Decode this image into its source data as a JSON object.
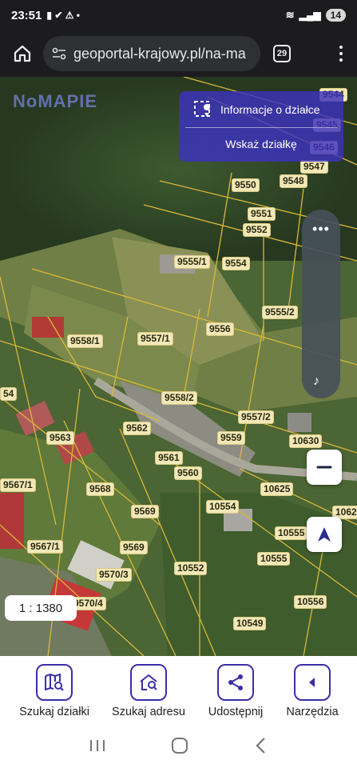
{
  "status": {
    "time": "23:51",
    "battery": "14"
  },
  "browser": {
    "url": "geoportal-krajowy.pl/na-ma",
    "tab_count": "29"
  },
  "map": {
    "logo": "NoMAPIE",
    "info_panel": {
      "title": "Informacje o działce",
      "action": "Wskaż działkę"
    },
    "zoom_dots": "•••",
    "scale": "1 : 1380",
    "parcels": [
      "9544",
      "9545",
      "9546",
      "9547",
      "9550",
      "9548",
      "9551",
      "9552",
      "9555/1",
      "9554",
      "9555/2",
      "9556",
      "9558/1",
      "9557/1",
      "9558/2",
      "9557/2",
      "9559",
      "10630",
      "9563",
      "9562",
      "9561",
      "9560",
      "9567/1",
      "9568",
      "9569",
      "10554",
      "10625",
      "10555",
      "9567/1",
      "9569",
      "10552",
      "10555",
      "9570/3",
      "9570/4",
      "10556",
      "10549",
      "1062",
      "54"
    ]
  },
  "bottom_nav": [
    {
      "label": "Szukaj działki",
      "icon": "map-search-icon"
    },
    {
      "label": "Szukaj adresu",
      "icon": "home-search-icon"
    },
    {
      "label": "Udostępnij",
      "icon": "share-icon"
    },
    {
      "label": "Narzędzia",
      "icon": "chevron-left-icon"
    }
  ]
}
